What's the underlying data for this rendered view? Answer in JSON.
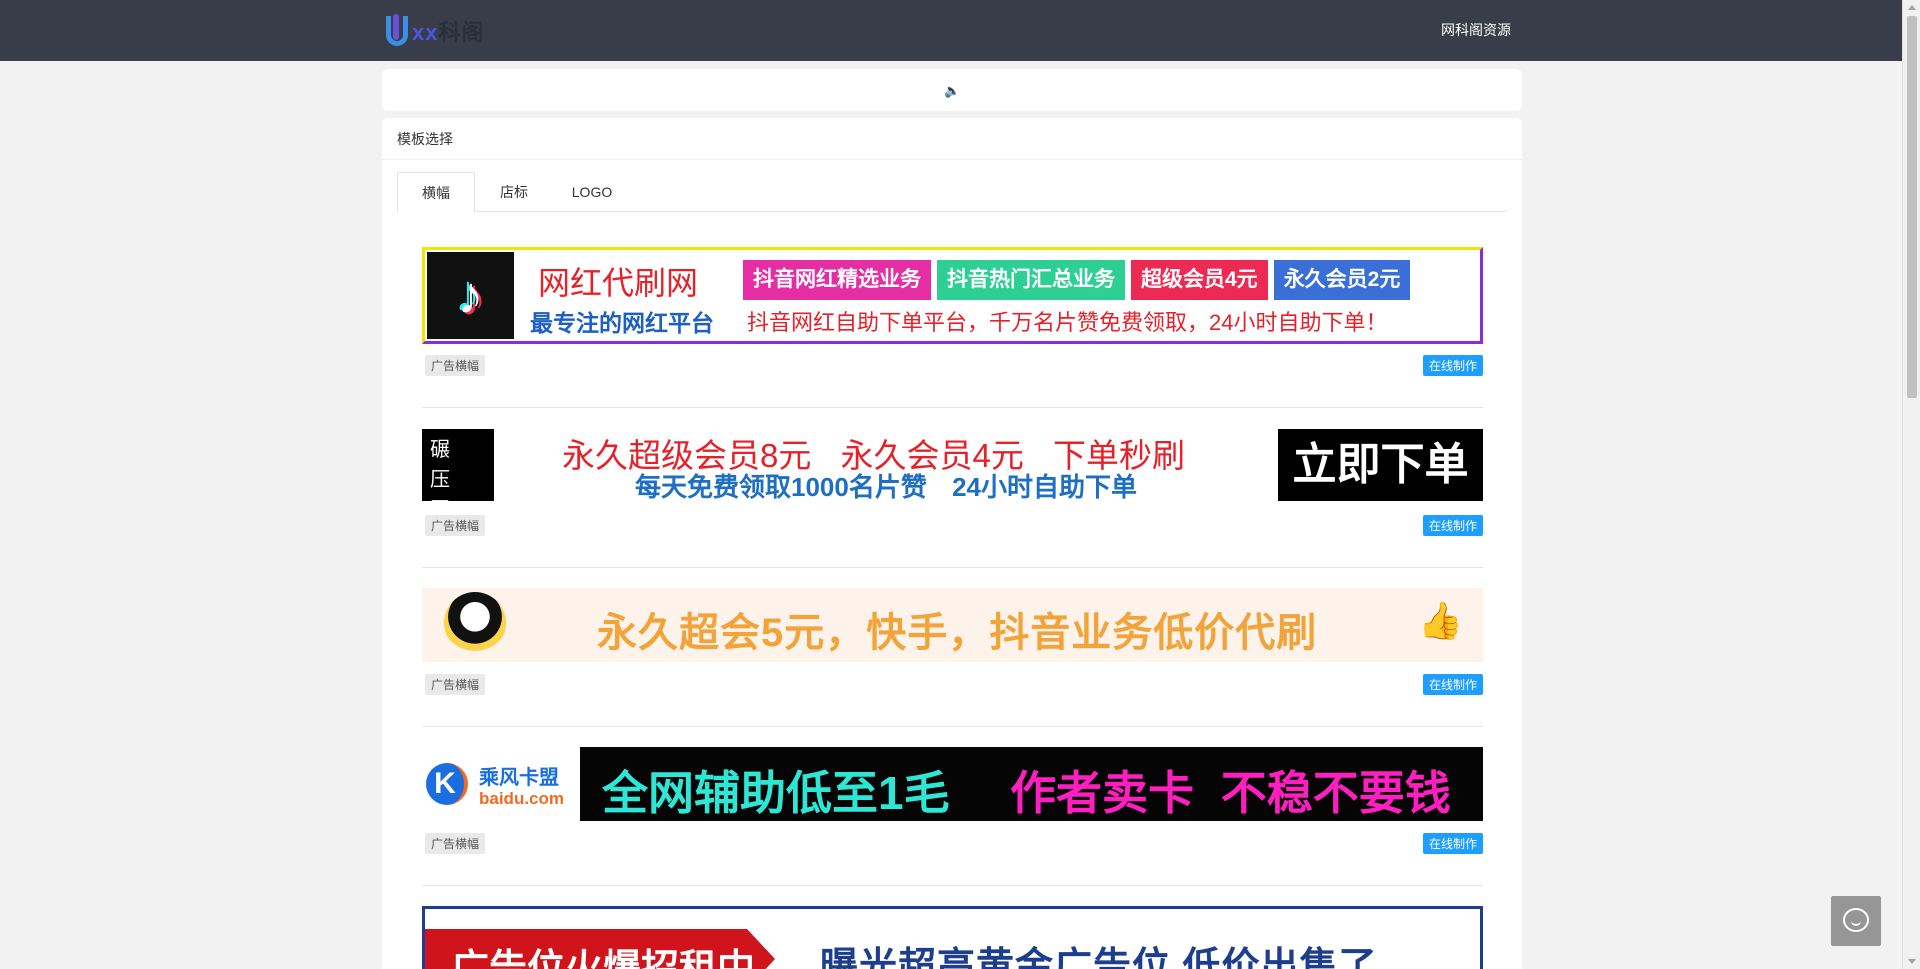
{
  "header": {
    "logo_text_a": "xx",
    "logo_text_b": "科阁",
    "nav_link": "网科阁资源"
  },
  "notice": {
    "icon": "speaker-icon"
  },
  "card": {
    "title": "模板选择",
    "tabs": [
      {
        "label": "横幅",
        "active": true
      },
      {
        "label": "店标",
        "active": false
      },
      {
        "label": "LOGO",
        "active": false
      }
    ]
  },
  "items": [
    {
      "tag": "广告横幅",
      "action": "在线制作",
      "banner": {
        "title": "网红代刷网",
        "subtitle": "最专注的网红平台",
        "pills": [
          "抖音网红精选业务",
          "抖音热门汇总业务",
          "超级会员4元",
          "永久会员2元"
        ],
        "desc": "抖音网红自助下单平台，千万名片赞免费领取，24小时自助下单！"
      }
    },
    {
      "tag": "广告横幅",
      "action": "在线制作",
      "banner": {
        "left_text": "碾压同行",
        "line1": "永久超级会员8元 永久会员4元 下单秒刷",
        "line2": "每天免费领取1000名片赞 24小时自助下单",
        "button": "立即下单"
      }
    },
    {
      "tag": "广告横幅",
      "action": "在线制作",
      "banner": {
        "text": "永久超会5元，快手，抖音业务低价代刷"
      }
    },
    {
      "tag": "广告横幅",
      "action": "在线制作",
      "banner": {
        "brand": "乘风卡盟",
        "domain": "baidu.com",
        "text_a": "全网辅助低至1毛",
        "text_b": "作者卖卡 不稳不要钱"
      }
    },
    {
      "banner": {
        "red_text": "广告位火爆招租中",
        "text": "曝光超高黄金广告位 低价出售了"
      }
    }
  ],
  "colors": {
    "topbar": "#393d49",
    "accent_blue": "#1e9fff",
    "page_bg": "#f2f2f2"
  }
}
